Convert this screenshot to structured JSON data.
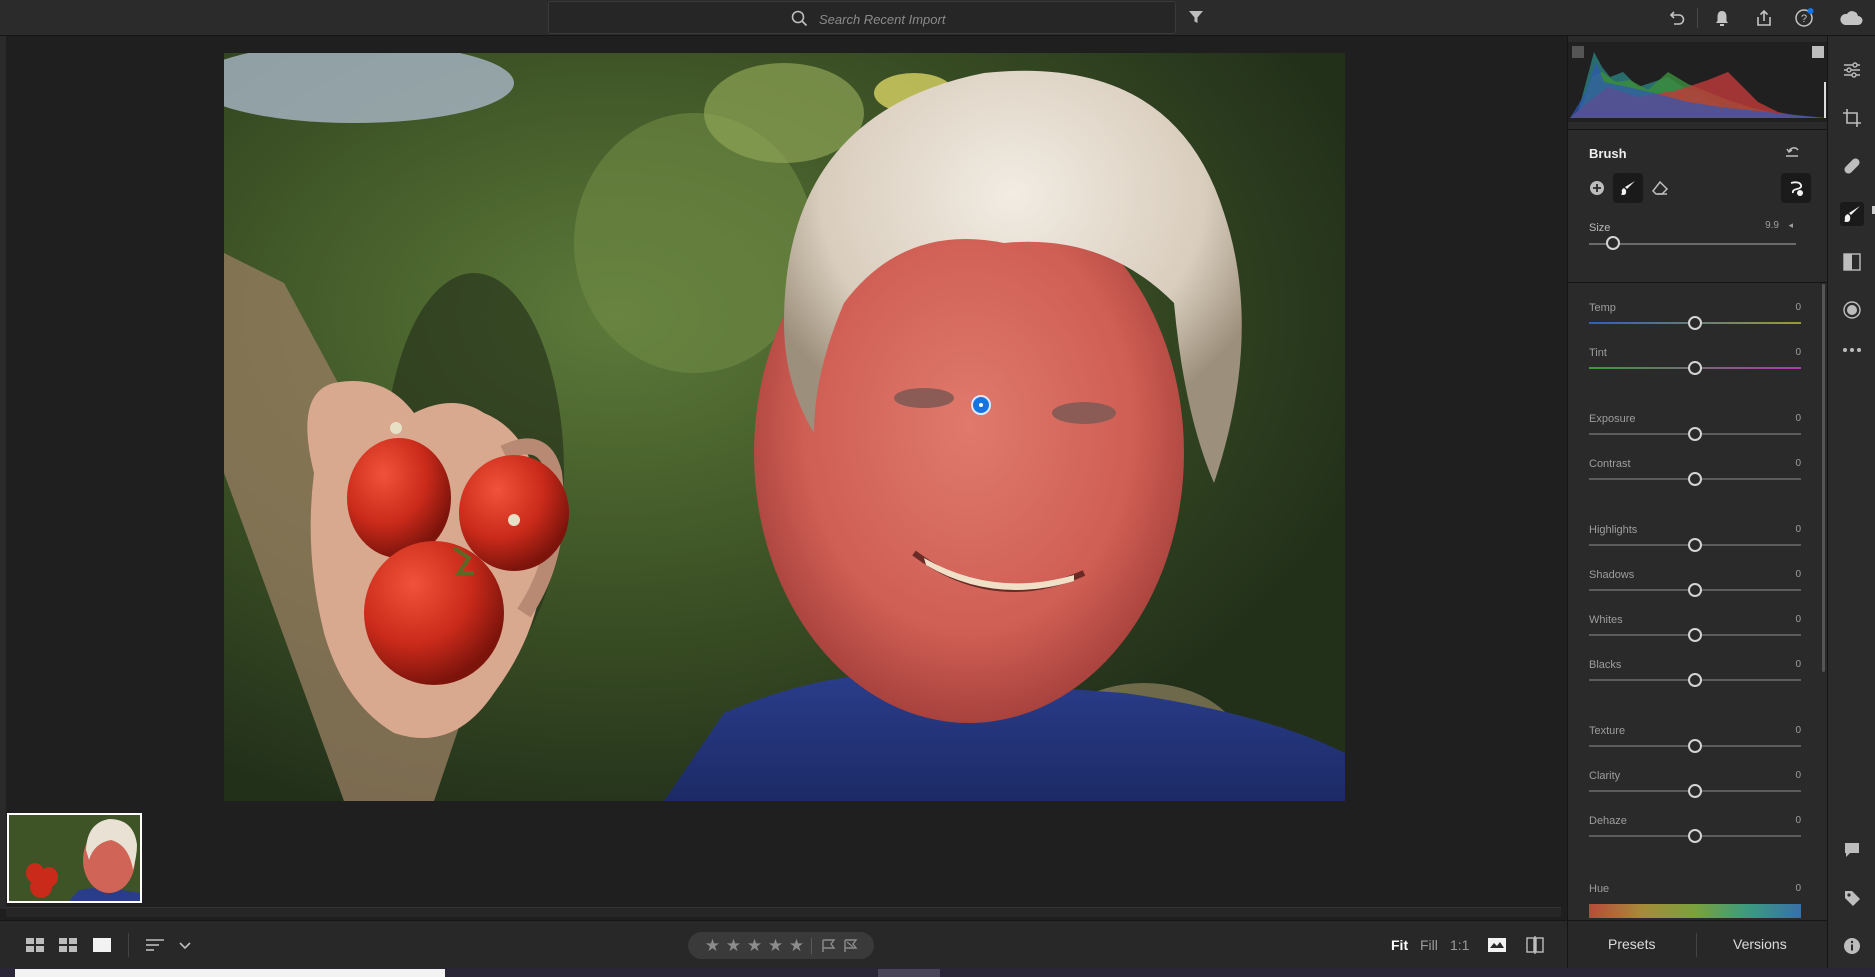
{
  "search": {
    "placeholder": "Search Recent Import"
  },
  "panel": {
    "title": "Brush",
    "size": {
      "label": "Size",
      "value": "9.9",
      "caret": "◂"
    },
    "params": [
      {
        "label": "Temp",
        "value": "0"
      },
      {
        "label": "Tint",
        "value": "0"
      },
      {
        "label": "Exposure",
        "value": "0"
      },
      {
        "label": "Contrast",
        "value": "0"
      },
      {
        "label": "Highlights",
        "value": "0"
      },
      {
        "label": "Shadows",
        "value": "0"
      },
      {
        "label": "Whites",
        "value": "0"
      },
      {
        "label": "Blacks",
        "value": "0"
      },
      {
        "label": "Texture",
        "value": "0"
      },
      {
        "label": "Clarity",
        "value": "0"
      },
      {
        "label": "Dehaze",
        "value": "0"
      },
      {
        "label": "Hue",
        "value": "0"
      }
    ],
    "presets_label": "Presets",
    "versions_label": "Versions"
  },
  "bottom": {
    "zoom": {
      "fit": "Fit",
      "fill": "Fill",
      "one_to_one": "1:1"
    },
    "stars": [
      "★",
      "★",
      "★",
      "★",
      "★"
    ]
  },
  "colors": {
    "accent": "#1473e6",
    "panel": "#2a2a2a",
    "bar": "#2b2b2b"
  },
  "icons": [
    "search-icon",
    "filter-icon",
    "undo-icon",
    "bell-icon",
    "share-icon",
    "help-icon",
    "cloud-icon",
    "edit-sliders-icon",
    "crop-icon",
    "healing-icon",
    "brush-icon",
    "linear-gradient-icon",
    "radial-gradient-icon",
    "more-icon",
    "comment-icon",
    "tag-icon",
    "info-icon"
  ]
}
